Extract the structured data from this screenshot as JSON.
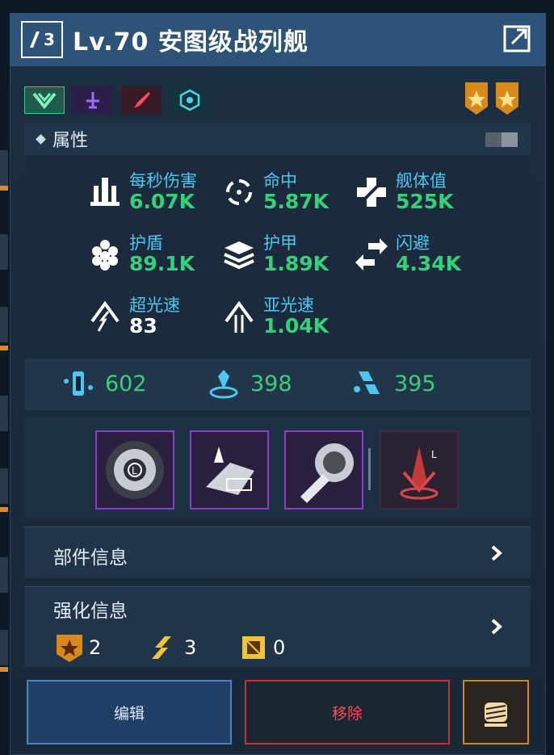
{
  "header": {
    "rank_number": "3",
    "title": "Lv.70 安图级战列舰"
  },
  "tags": [
    {
      "icon": "chevron-rank-icon",
      "color": "#3fbf8f"
    },
    {
      "icon": "anchor-icon",
      "color": "#8a4fd6"
    },
    {
      "icon": "missile-icon",
      "color": "#e0344b"
    },
    {
      "icon": "atom-icon",
      "color": "#39b6c9"
    }
  ],
  "medals": [
    "star-medal-icon",
    "star-medal-icon"
  ],
  "attributes": {
    "heading": "属性",
    "stats": [
      {
        "label": "每秒伤害",
        "value": "6.07K",
        "icon": "turret-icon"
      },
      {
        "label": "命中",
        "value": "5.87K",
        "icon": "crosshair-icon"
      },
      {
        "label": "舰体值",
        "value": "525K",
        "icon": "hull-cross-icon"
      },
      {
        "label": "护盾",
        "value": "89.1K",
        "icon": "shield-hex-icon"
      },
      {
        "label": "护甲",
        "value": "1.89K",
        "icon": "armor-layers-icon"
      },
      {
        "label": "闪避",
        "value": "4.34K",
        "icon": "evade-arrows-icon"
      },
      {
        "label": "超光速",
        "value": "83",
        "icon": "ftl-arrow-icon"
      },
      {
        "label": "亚光速",
        "value": "1.04K",
        "icon": "sublight-arrow-icon"
      }
    ]
  },
  "resources": [
    {
      "value": "602",
      "icon": "metal-icon"
    },
    {
      "value": "398",
      "icon": "crystal-icon"
    },
    {
      "value": "395",
      "icon": "deuterium-icon"
    }
  ],
  "skills": [
    {
      "icon": "vortex-skill-icon",
      "color": "#8a3fc6"
    },
    {
      "icon": "boost-skill-icon",
      "color": "#8a3fc6"
    },
    {
      "icon": "scan-skill-icon",
      "color": "#8a3fc6"
    },
    {
      "icon": "burst-skill-icon",
      "color": "#c23a3a"
    }
  ],
  "parts_info": {
    "label": "部件信息"
  },
  "enhance_info": {
    "label": "强化信息",
    "counts": [
      {
        "icon": "star-badge-icon",
        "value": "2"
      },
      {
        "icon": "rank-slash-icon",
        "value": "3"
      },
      {
        "icon": "chip-icon",
        "value": "0"
      }
    ]
  },
  "buttons": {
    "edit": "编辑",
    "remove": "移除"
  }
}
